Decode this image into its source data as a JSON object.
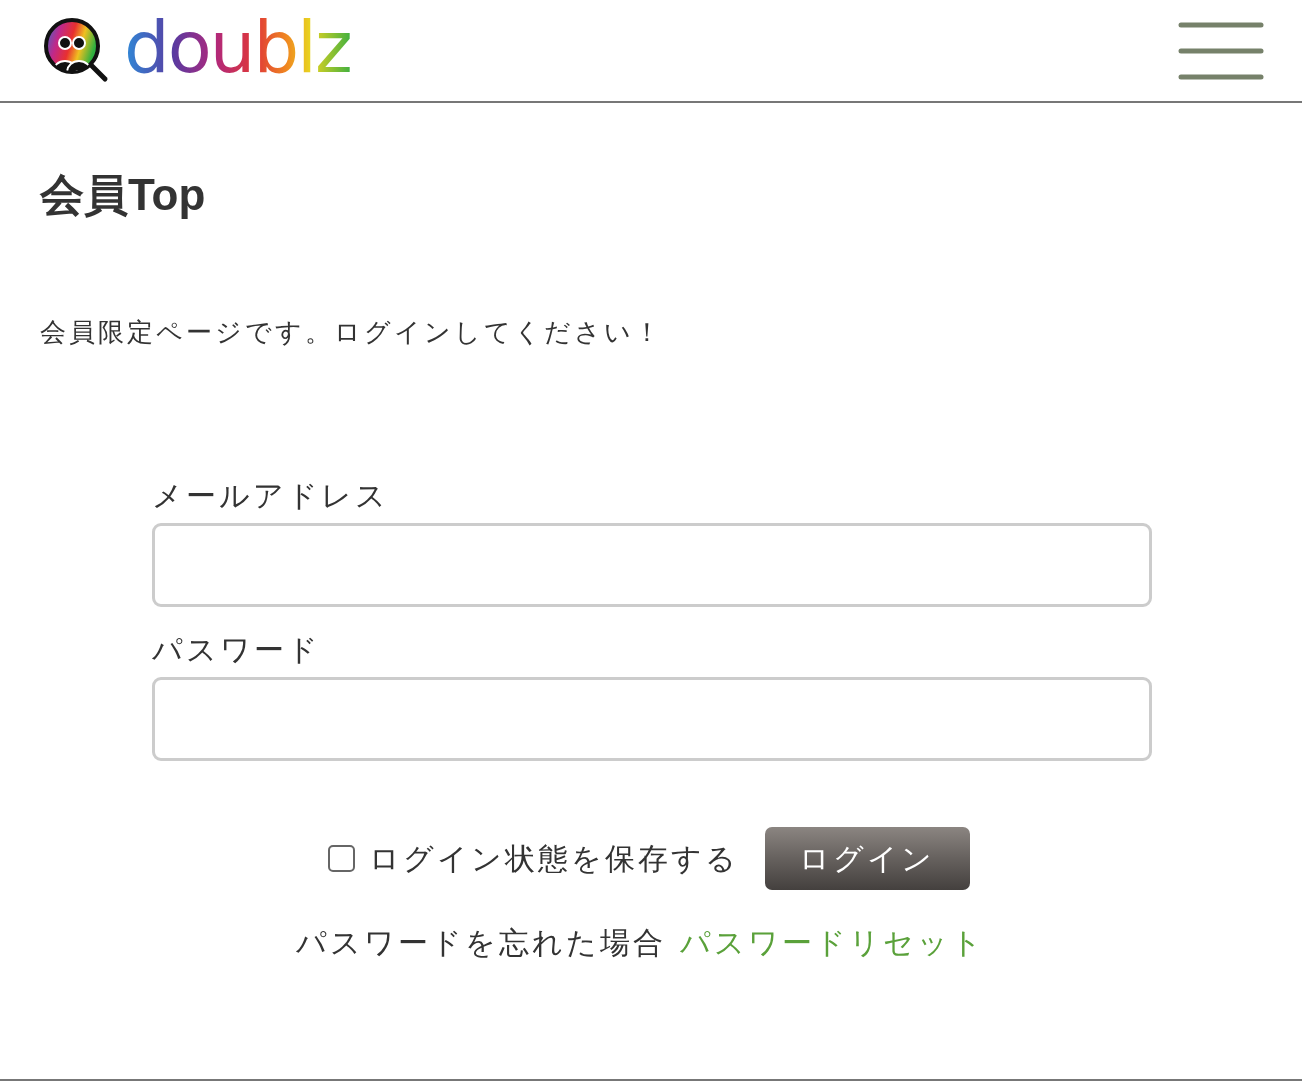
{
  "header": {
    "logo_text": "doublz"
  },
  "page": {
    "title": "会員Top",
    "message": "会員限定ページです。ログインしてください！"
  },
  "form": {
    "fields": [
      {
        "label": "メールアドレス"
      },
      {
        "label": "パスワード"
      }
    ],
    "remember": {
      "label": "ログイン状態を保存する",
      "checked": false
    },
    "submit": "ログイン",
    "forgot": {
      "text": "パスワードを忘れた場合",
      "link": "パスワードリセット"
    }
  }
}
